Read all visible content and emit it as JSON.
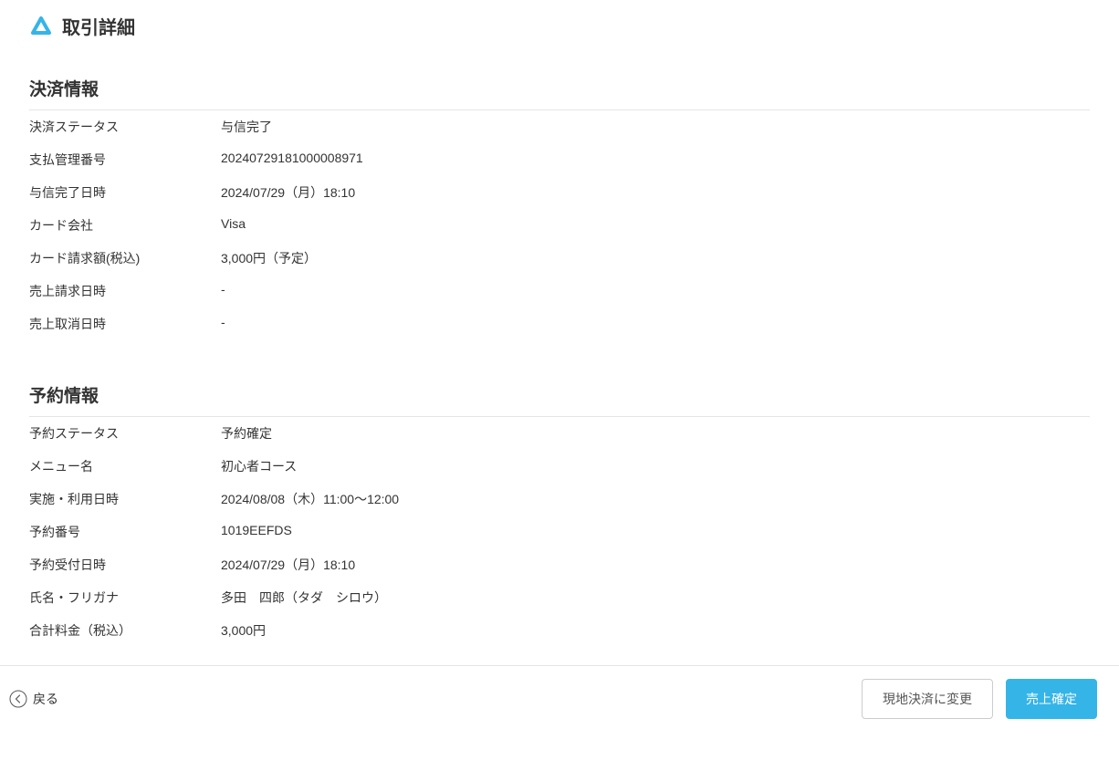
{
  "page": {
    "title": "取引詳細"
  },
  "payment": {
    "section_title": "決済情報",
    "rows": {
      "status_label": "決済ステータス",
      "status_value": "与信完了",
      "management_number_label": "支払管理番号",
      "management_number_value": "20240729181000008971",
      "auth_complete_date_label": "与信完了日時",
      "auth_complete_date_value": "2024/07/29（月）18:10",
      "card_company_label": "カード会社",
      "card_company_value": "Visa",
      "card_charge_label": "カード請求額(税込)",
      "card_charge_value": "3,000円（予定）",
      "sales_request_date_label": "売上請求日時",
      "sales_request_date_value": "-",
      "sales_cancel_date_label": "売上取消日時",
      "sales_cancel_date_value": "-"
    }
  },
  "reservation": {
    "section_title": "予約情報",
    "rows": {
      "status_label": "予約ステータス",
      "status_value": "予約確定",
      "menu_name_label": "メニュー名",
      "menu_name_value": "初心者コース",
      "usage_date_label": "実施・利用日時",
      "usage_date_value": "2024/08/08（木）11:00〜12:00",
      "reservation_number_label": "予約番号",
      "reservation_number_value": "1019EEFDS",
      "reservation_accept_date_label": "予約受付日時",
      "reservation_accept_date_value": "2024/07/29（月）18:10",
      "name_label": "氏名・フリガナ",
      "name_value": "多田　四郎（タダ　シロウ）",
      "total_label": "合計料金（税込）",
      "total_value": "3,000円"
    }
  },
  "footer": {
    "back_label": "戻る",
    "change_to_onsite_label": "現地決済に変更",
    "confirm_sales_label": "売上確定"
  }
}
